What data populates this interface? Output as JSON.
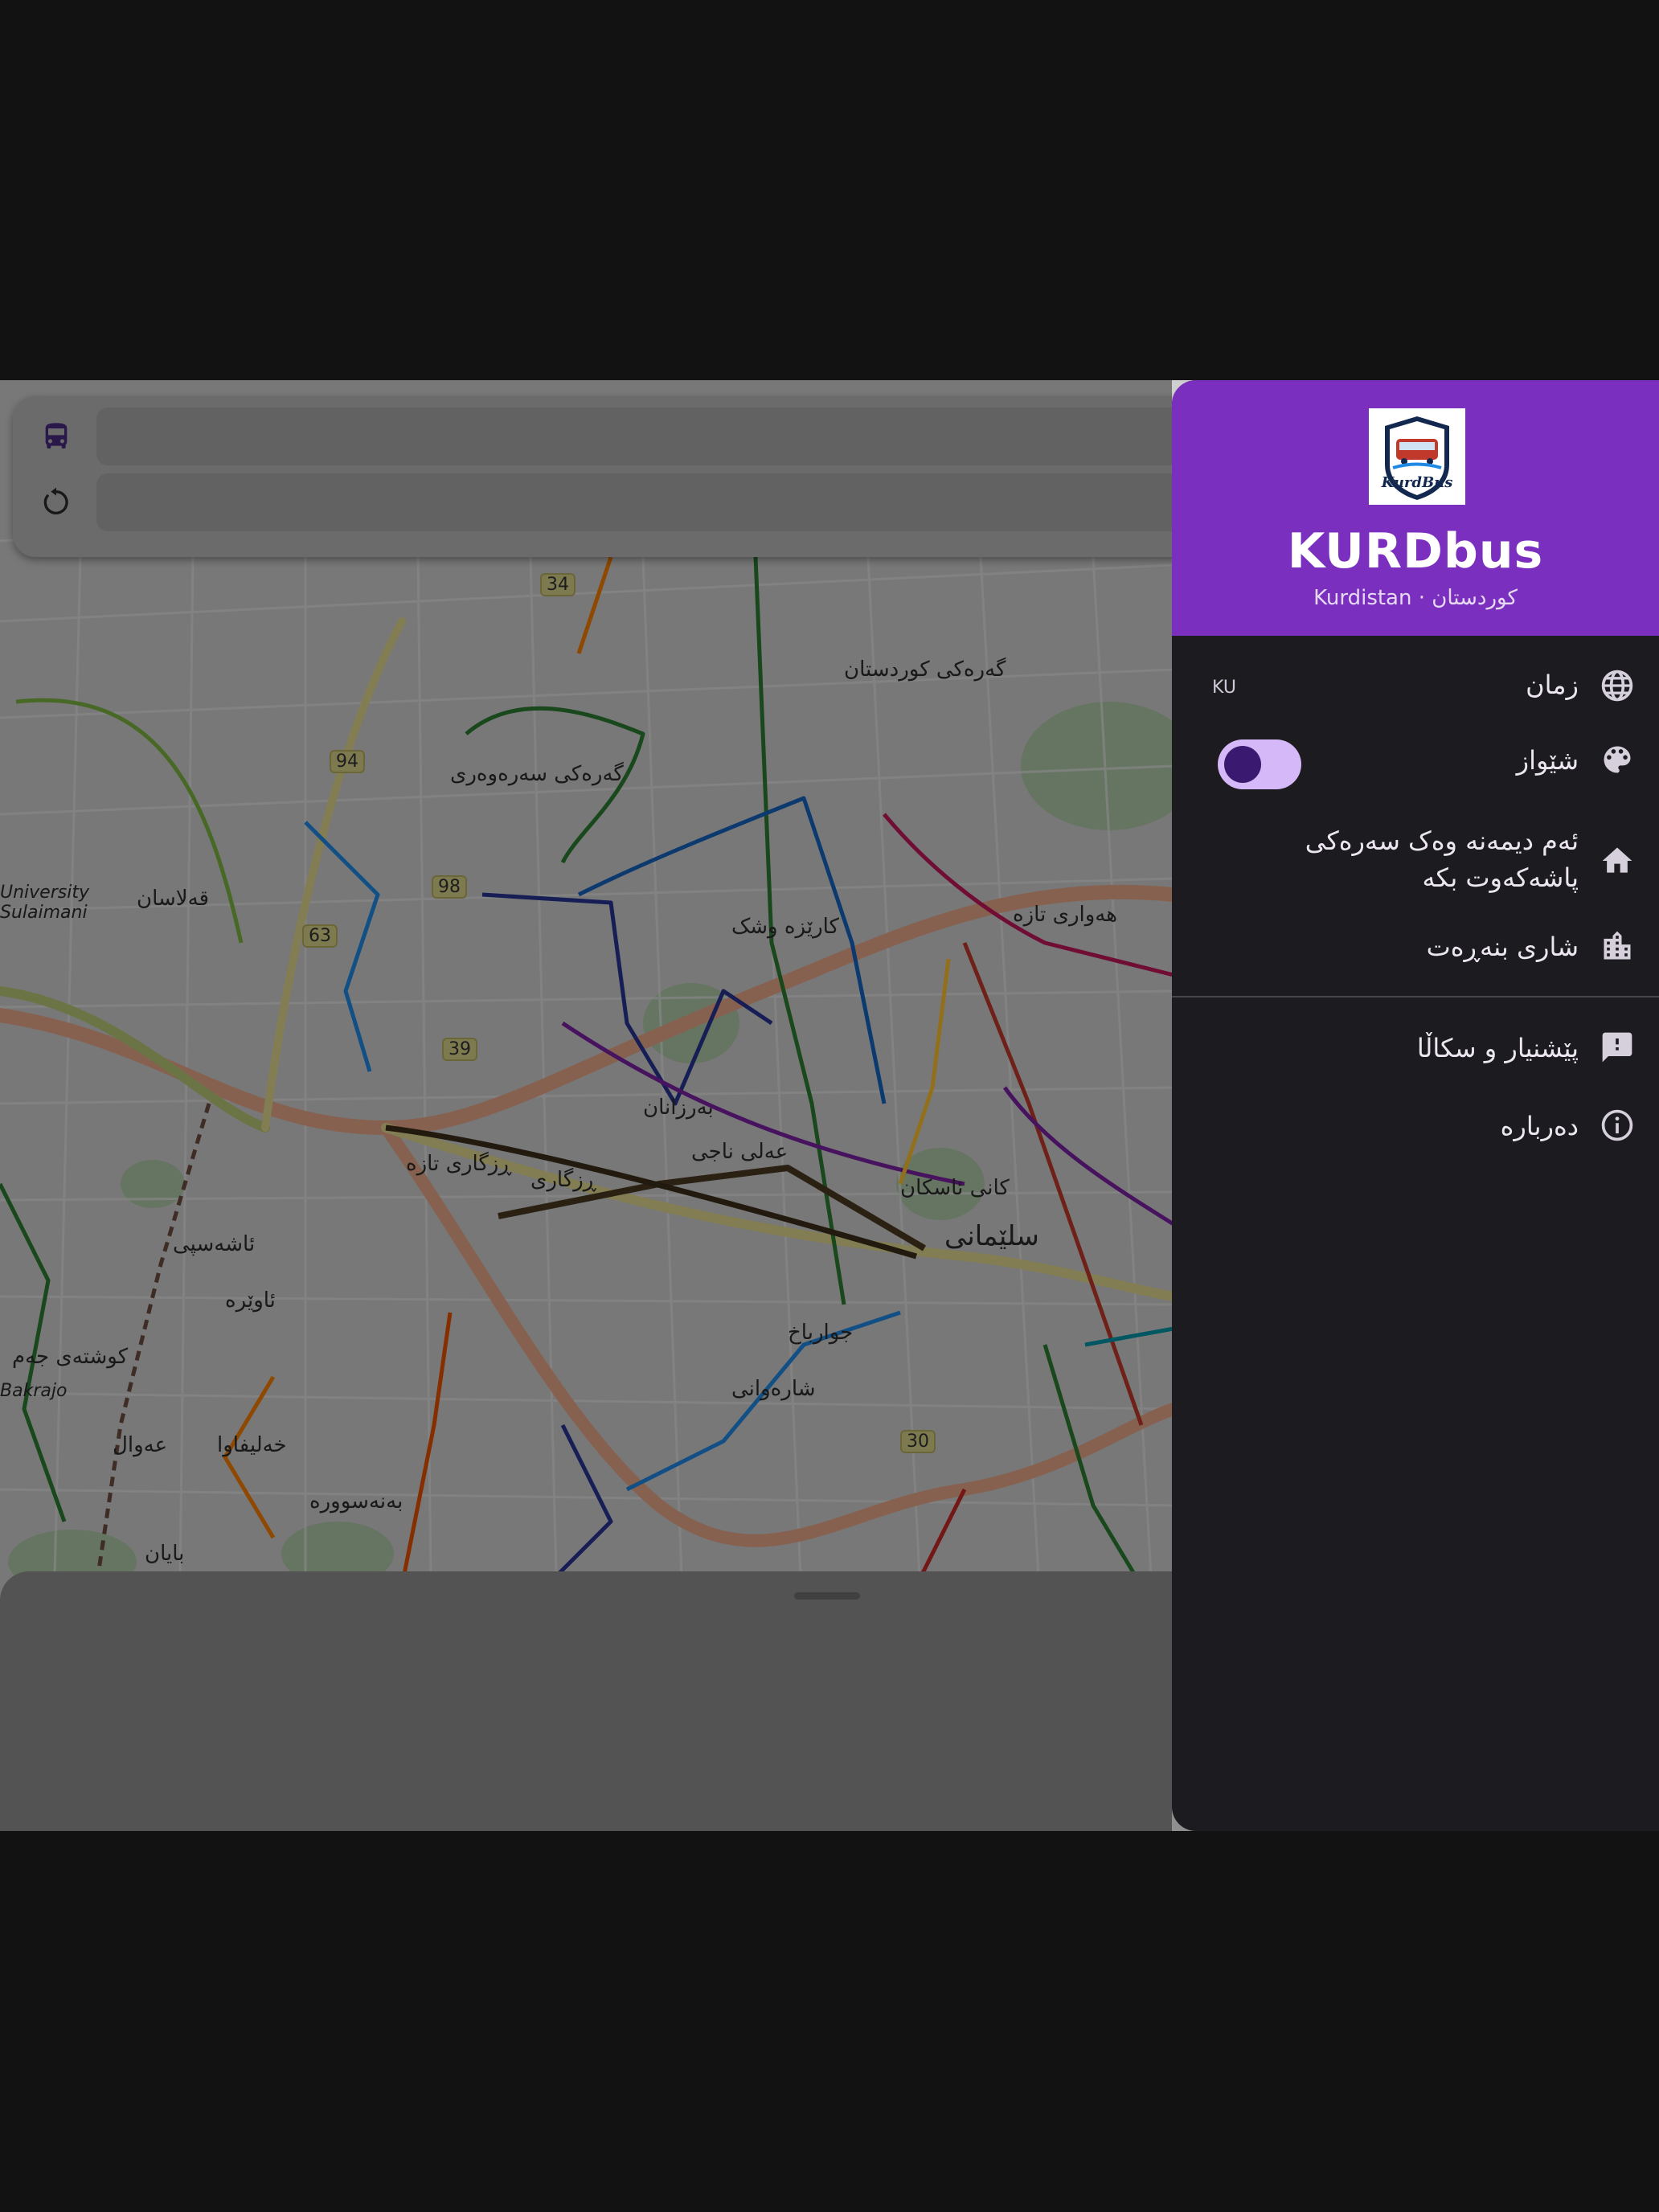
{
  "map": {
    "labels": [
      {
        "text": "گەرەکی کوردستان",
        "cls": "l-kurdistan"
      },
      {
        "text": "گەرەکی سەرەوەری",
        "cls": "l-sarawari"
      },
      {
        "text": "قەلاسان",
        "cls": "l-qalasan"
      },
      {
        "text": "کارێزە وشک",
        "cls": "l-karez"
      },
      {
        "text": "هەواری تازە",
        "cls": "l-hawari"
      },
      {
        "text": "بەرزانان",
        "cls": "l-barzanan"
      },
      {
        "text": "عەلی ناجی",
        "cls": "l-ali"
      },
      {
        "text": "ڕزگاری تازە",
        "cls": "l-rizgari-taza"
      },
      {
        "text": "ڕزگاری",
        "cls": "l-rizgari"
      },
      {
        "text": "کانی ئاسکان",
        "cls": "l-kani"
      },
      {
        "text": "سلێمانی",
        "cls": "l-slemani"
      },
      {
        "text": "ئاشەسپی",
        "cls": "l-ashaspi"
      },
      {
        "text": "ئاوێرە",
        "cls": "l-awera"
      },
      {
        "text": "جوارباخ",
        "cls": "l-jwarbax"
      },
      {
        "text": "شارەوانی",
        "cls": "l-sharawani"
      },
      {
        "text": "کوشتەی جەم",
        "cls": "l-kushta"
      },
      {
        "text": "عەوال",
        "cls": "l-awal"
      },
      {
        "text": "خەلیفاوا",
        "cls": "l-xalifawa"
      },
      {
        "text": "بەنەسوورە",
        "cls": "l-banasura"
      },
      {
        "text": "بایان",
        "cls": "l-bayan"
      },
      {
        "text": "University Sulaimani",
        "cls": "l-univ"
      },
      {
        "text": "Bakrajo",
        "cls": "l-bakrajo"
      }
    ],
    "route_badges": [
      "34",
      "94",
      "98",
      "63",
      "39",
      "30"
    ]
  },
  "search": {
    "bus_icon": "bus-icon",
    "swap_icon": "refresh-icon"
  },
  "drawer": {
    "app_title": "KURDbus",
    "app_subtitle": "Kurdistan · کوردستان",
    "logo_text": "KurdBus",
    "items": {
      "language": {
        "label": "زمان",
        "value": "KU",
        "icon": "globe-icon"
      },
      "theme": {
        "label": "شێواز",
        "icon": "palette-icon",
        "toggle_on": true
      },
      "home": {
        "label": "ئەم دیمەنە وەک سەرەکی پاشەکەوت بکە",
        "icon": "home-icon"
      },
      "city": {
        "label": "شاری بنەڕەت",
        "icon": "city-icon"
      },
      "feedback": {
        "label": "پێشنیار و سکاڵا",
        "icon": "feedback-icon"
      },
      "about": {
        "label": "دەربارە",
        "icon": "info-icon"
      }
    }
  },
  "colors": {
    "accent": "#7b2fbe",
    "drawer_bg": "#1c1b1f",
    "toggle_track": "#d4b8f7",
    "toggle_knob": "#3a1a70"
  }
}
